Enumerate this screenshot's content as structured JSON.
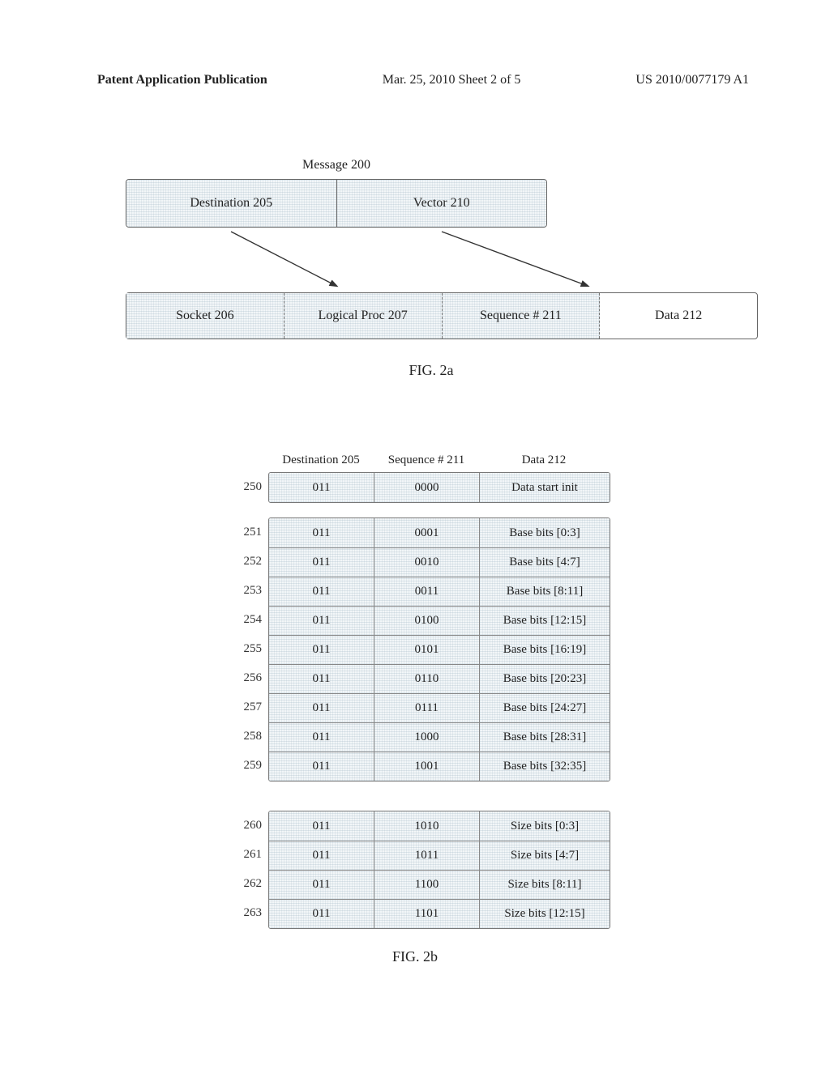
{
  "header": {
    "left": "Patent Application Publication",
    "mid": "Mar. 25, 2010  Sheet 2 of 5",
    "right": "US 2010/0077179 A1"
  },
  "fig2a": {
    "message_label": "Message 200",
    "top": {
      "dest": "Destination 205",
      "vect": "Vector 210"
    },
    "bottom": {
      "socket": "Socket 206",
      "lproc": "Logical Proc 207",
      "seq": "Sequence # 211",
      "data": "Data 212"
    },
    "caption": "FIG. 2a"
  },
  "fig2b": {
    "headers": {
      "dest": "Destination 205",
      "seq": "Sequence # 211",
      "data": "Data 212"
    },
    "g1": [
      {
        "label": "250",
        "dest": "011",
        "seq": "0000",
        "data": "Data start init"
      }
    ],
    "g2": [
      {
        "label": "251",
        "dest": "011",
        "seq": "0001",
        "data": "Base bits [0:3]"
      },
      {
        "label": "252",
        "dest": "011",
        "seq": "0010",
        "data": "Base bits [4:7]"
      },
      {
        "label": "253",
        "dest": "011",
        "seq": "0011",
        "data": "Base bits [8:11]"
      },
      {
        "label": "254",
        "dest": "011",
        "seq": "0100",
        "data": "Base bits [12:15]"
      },
      {
        "label": "255",
        "dest": "011",
        "seq": "0101",
        "data": "Base bits [16:19]"
      },
      {
        "label": "256",
        "dest": "011",
        "seq": "0110",
        "data": "Base bits [20:23]"
      },
      {
        "label": "257",
        "dest": "011",
        "seq": "0111",
        "data": "Base bits [24:27]"
      },
      {
        "label": "258",
        "dest": "011",
        "seq": "1000",
        "data": "Base bits [28:31]"
      },
      {
        "label": "259",
        "dest": "011",
        "seq": "1001",
        "data": "Base bits [32:35]"
      }
    ],
    "g3": [
      {
        "label": "260",
        "dest": "011",
        "seq": "1010",
        "data": "Size bits [0:3]"
      },
      {
        "label": "261",
        "dest": "011",
        "seq": "1011",
        "data": "Size bits [4:7]"
      },
      {
        "label": "262",
        "dest": "011",
        "seq": "1100",
        "data": "Size bits [8:11]"
      },
      {
        "label": "263",
        "dest": "011",
        "seq": "1101",
        "data": "Size bits [12:15]"
      }
    ],
    "caption": "FIG. 2b"
  }
}
